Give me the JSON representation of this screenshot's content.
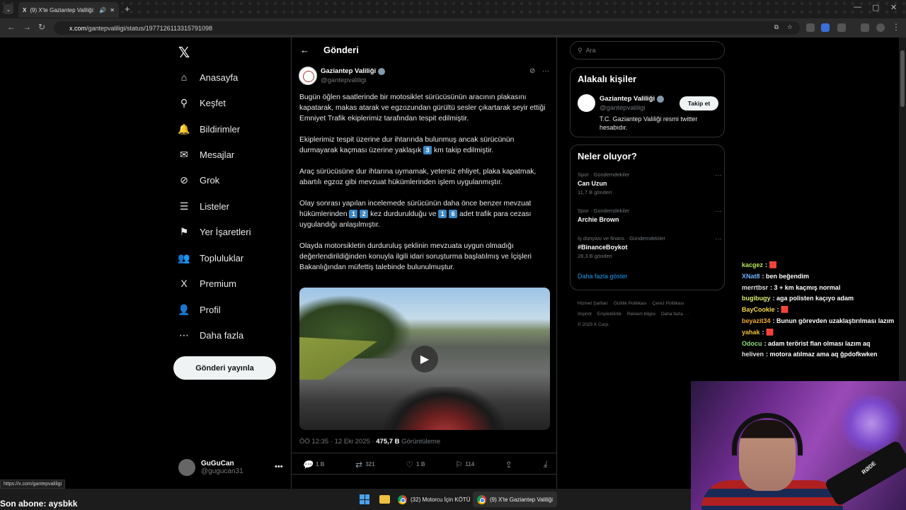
{
  "browser": {
    "tab_title": "(9) X'te Gaziantep Valiliği: \"",
    "url_host": "x.com",
    "url_path": "/gantepvaliligi/status/1977126113315791098"
  },
  "nav": {
    "items": [
      {
        "label": "Anasayfa",
        "icon": "⌂"
      },
      {
        "label": "Keşfet",
        "icon": "⚲"
      },
      {
        "label": "Bildirimler",
        "icon": "🔔"
      },
      {
        "label": "Mesajlar",
        "icon": "✉"
      },
      {
        "label": "Grok",
        "icon": "⊘"
      },
      {
        "label": "Listeler",
        "icon": "☰"
      },
      {
        "label": "Yer İşaretleri",
        "icon": "⚑"
      },
      {
        "label": "Topluluklar",
        "icon": "👥"
      },
      {
        "label": "Premium",
        "icon": "X"
      },
      {
        "label": "Profil",
        "icon": "👤"
      },
      {
        "label": "Daha fazla",
        "icon": "⋯"
      }
    ],
    "post_button": "Gönderi yayınla",
    "account_name": "GuGuCan",
    "account_handle": "@gugucan31"
  },
  "post": {
    "header": "Gönderi",
    "author": "Gaziantep Valiliği",
    "handle": "@gantepvaliligi",
    "p1": "Bugün öğlen saatlerinde bir motosiklet sürücüsünün aracının plakasını kapatarak, makas atarak ve egzozundan gürültü sesler çıkartarak seyir ettiği Emniyet Trafik ekiplerimiz tarafından tespit edilmiştir.",
    "p2a": "Ekiplerimiz tespit üzerine dur ihtarında  bulunmuş ancak sürücünün durmayarak kaçması üzerine yaklaşık ",
    "p2k": "3",
    "p2b": " km takip edilmiştir.",
    "p3": "Araç sürücüsüne dur ihtarına uymamak, yetersiz ehliyet, plaka kapatmak, abartılı egzoz gibi mevzuat hükümlerinden işlem uygulanmıştır.",
    "p4a": "Olay sonrası yapılan incelemede sürücünün daha önce benzer mevzuat hükümlerinden ",
    "p4k1": "1",
    "p4k2": "2",
    "p4b": " kez durdurulduğu ve ",
    "p4k3": "1",
    "p4k4": "6",
    "p4c": " adet trafik para cezası uygulandığı anlaşılmıştır.",
    "p5": "Olayda motorsikletin durduruluş şeklinin mevzuata uygun olmadığı değerlendirildiğinden konuyla ilgili idari soruşturma başlatılmış ve İçişleri Bakanlığından müfettiş talebinde bulunulmuştur.",
    "time": "ÖÖ 12:35 · 12 Eki 2025 · ",
    "views": "475,7 B",
    "views_label": " Görüntüleme",
    "replies": "1 B",
    "reposts": "321",
    "likes": "1 B",
    "bookmarks": "114"
  },
  "sidebar": {
    "search_placeholder": "Ara",
    "related_title": "Alakalı kişiler",
    "related_name": "Gaziantep Valiliği",
    "related_handle": "@gantepvaliligi",
    "related_bio": "T.C. Gaziantep Valiliği resmi twitter hesabıdır.",
    "follow": "Takip et",
    "trends_title": "Neler oluyor?",
    "trends": [
      {
        "cat": "Spor · Gündemdekiler",
        "title": "Can Uzun",
        "count": "11,7 B gönderi"
      },
      {
        "cat": "Spor · Gündemdekiler",
        "title": "Archie Brown",
        "count": ""
      },
      {
        "cat": "İş dünyası ve finans · Gündemdekiler",
        "title": "#BinanceBoykot",
        "count": "28,3 B gönderi"
      }
    ],
    "show_more": "Daha fazla göster",
    "footer": [
      "Hizmet Şartları",
      "Gizlilik Politikası",
      "Çerez Politikası",
      "Imprint",
      "Erişilebilirlik",
      "Reklam bilgisi",
      "Daha fazla ···",
      "© 2025 X Corp."
    ]
  },
  "chat": [
    {
      "user": "kacgez",
      "color": "#b6e85a",
      "msg": ": 🟥"
    },
    {
      "user": "XNat8",
      "color": "#6fb3ff",
      "msg": ": ben beğendim"
    },
    {
      "user": "merrtbsr",
      "color": "#e0e0e0",
      "msg": ": 3 + km kaçmış normal"
    },
    {
      "user": "bugibugy",
      "color": "#d9f06a",
      "msg": ": aga polisten kaçıyo adam"
    },
    {
      "user": "BayCookie",
      "color": "#f5d84a",
      "msg": ": 🟥"
    },
    {
      "user": "beyazit34",
      "color": "#f0a830",
      "msg": ": Bunun görevden uzaklaştırılması lazım"
    },
    {
      "user": "yahak",
      "color": "#f0c040",
      "msg": ": 🟥"
    },
    {
      "user": "Odocu",
      "color": "#8fe07a",
      "msg": ": adam terörist flan olması lazım aq"
    },
    {
      "user": "heliven",
      "color": "#e0e0e0",
      "msg": ": motora atılmaz ama aq ğpdofkwken"
    }
  ],
  "status_link": "https://x.com/gantepvaliligi",
  "subline": "Son abone: aysbkk",
  "taskbar": {
    "item1": "(32) Motorcu İçin KÖTÜ",
    "item2": "(9) X'te Gaziantep Valiliği"
  },
  "cam_label": "RØDE"
}
